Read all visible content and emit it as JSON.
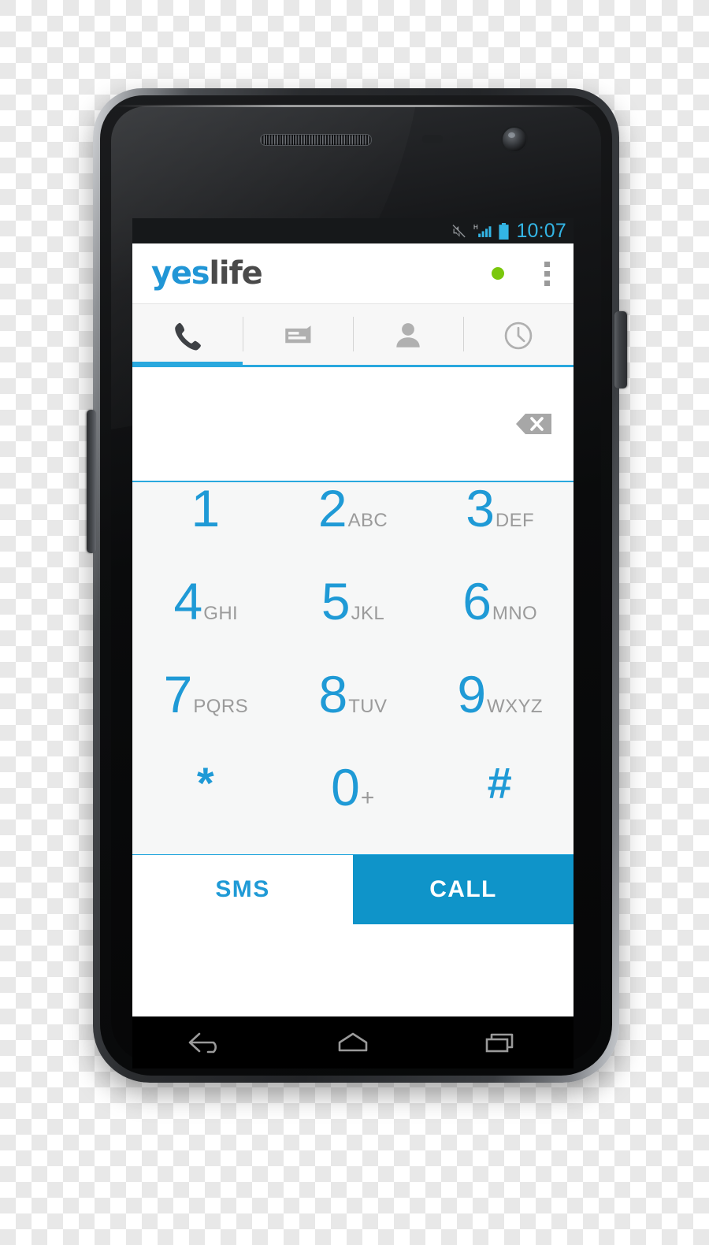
{
  "device": {
    "hardware": {
      "earpiece": "earpiece-grille",
      "proximity_sensor": "proximity-sensor",
      "light_sensor": "light-sensor",
      "front_camera": "front-camera",
      "power_key": "power-button",
      "volume_key": "volume-rocker"
    }
  },
  "status_bar": {
    "time": "10:07",
    "icons": [
      "mute-icon",
      "signal-h-icon",
      "battery-icon"
    ],
    "network_type": "H",
    "time_color": "#33b5e5",
    "background": "#16181a"
  },
  "action_bar": {
    "brand_first": "yes",
    "brand_second": "life",
    "brand_first_color": "#2196d6",
    "brand_second_color": "#4a4a4a",
    "status_dot_color": "#7ac70c",
    "overflow_icon": "overflow-menu-icon"
  },
  "tabs": [
    {
      "id": "dialer",
      "icon": "phone-icon",
      "active": true
    },
    {
      "id": "messages",
      "icon": "message-icon",
      "active": false
    },
    {
      "id": "contacts",
      "icon": "person-icon",
      "active": false
    },
    {
      "id": "recents",
      "icon": "clock-icon",
      "active": false
    }
  ],
  "dial_input": {
    "value": "",
    "placeholder": "",
    "backspace_icon": "backspace-icon",
    "underline_color": "#29a8de"
  },
  "keypad": {
    "keys": [
      {
        "digit": "1",
        "letters": ""
      },
      {
        "digit": "2",
        "letters": "ABC"
      },
      {
        "digit": "3",
        "letters": "DEF"
      },
      {
        "digit": "4",
        "letters": "GHI"
      },
      {
        "digit": "5",
        "letters": "JKL"
      },
      {
        "digit": "6",
        "letters": "MNO"
      },
      {
        "digit": "7",
        "letters": "PQRS"
      },
      {
        "digit": "8",
        "letters": "TUV"
      },
      {
        "digit": "9",
        "letters": "WXYZ"
      },
      {
        "digit": "*",
        "letters": ""
      },
      {
        "digit": "0",
        "letters": "+"
      },
      {
        "digit": "#",
        "letters": ""
      }
    ],
    "digit_color": "#1f9ad6",
    "letters_color": "#9b9b9b",
    "background": "#f6f7f7"
  },
  "bottom_actions": {
    "sms_label": "SMS",
    "call_label": "CALL",
    "sms_bg": "#ffffff",
    "sms_color": "#1f9ad6",
    "call_bg": "#0f94c9",
    "call_color": "#ffffff"
  },
  "nav_bar": {
    "buttons": [
      {
        "id": "back",
        "icon": "back-icon"
      },
      {
        "id": "home",
        "icon": "home-icon"
      },
      {
        "id": "recents",
        "icon": "recents-icon"
      }
    ],
    "background": "#000000",
    "icon_color": "#9a9a9a"
  }
}
